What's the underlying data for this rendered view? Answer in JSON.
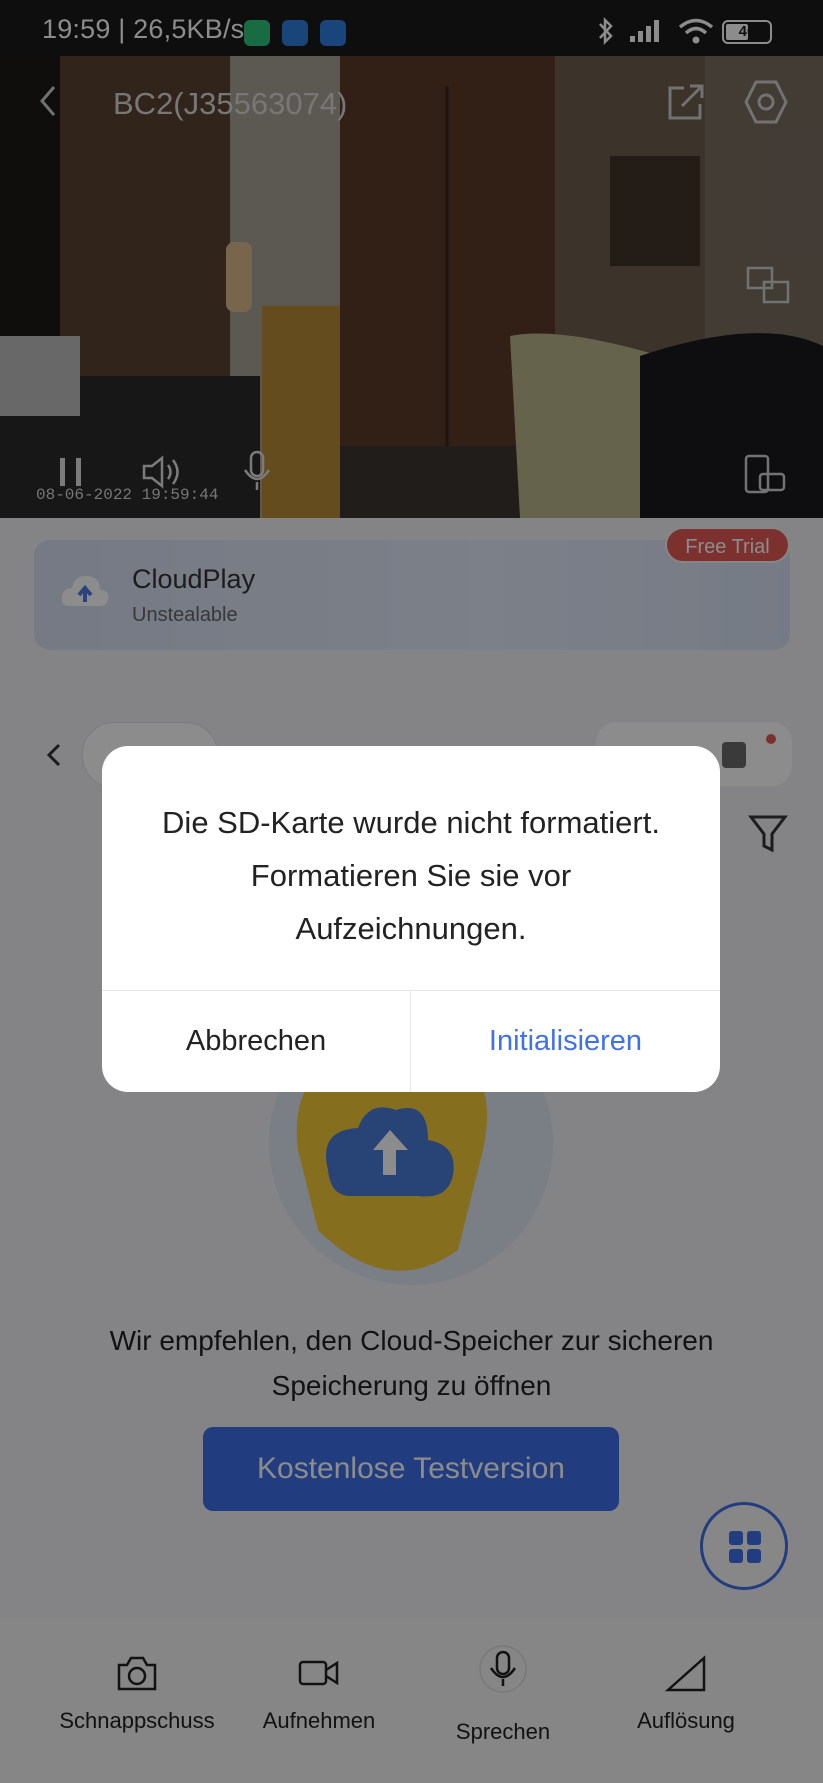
{
  "status_bar": {
    "time_speed": "19:59 | 26,5KB/s",
    "battery": "46"
  },
  "video": {
    "device_title": "BC2(J35563074)",
    "timestamp": "08-06-2022 19:59:44"
  },
  "cloud_banner": {
    "title": "CloudPlay",
    "subtitle": "Unstealable",
    "badge": "Free Trial"
  },
  "main": {
    "recommendation": "Wir empfehlen, den Cloud-Speicher zur sicheren Speicherung zu öffnen",
    "trial_button": "Kostenlose Testversion"
  },
  "bottom_bar": {
    "snapshot": "Schnappschuss",
    "record": "Aufnehmen",
    "speak": "Sprechen",
    "resolution": "Auflösung"
  },
  "dialog": {
    "message": "Die SD-Karte wurde nicht formatiert. Formatieren Sie sie vor Aufzeichnungen.",
    "cancel": "Abbrechen",
    "confirm": "Initialisieren"
  },
  "colors": {
    "accent": "#3f6fe8",
    "badge": "#e25a57",
    "dialog_link": "#3f72e6"
  }
}
